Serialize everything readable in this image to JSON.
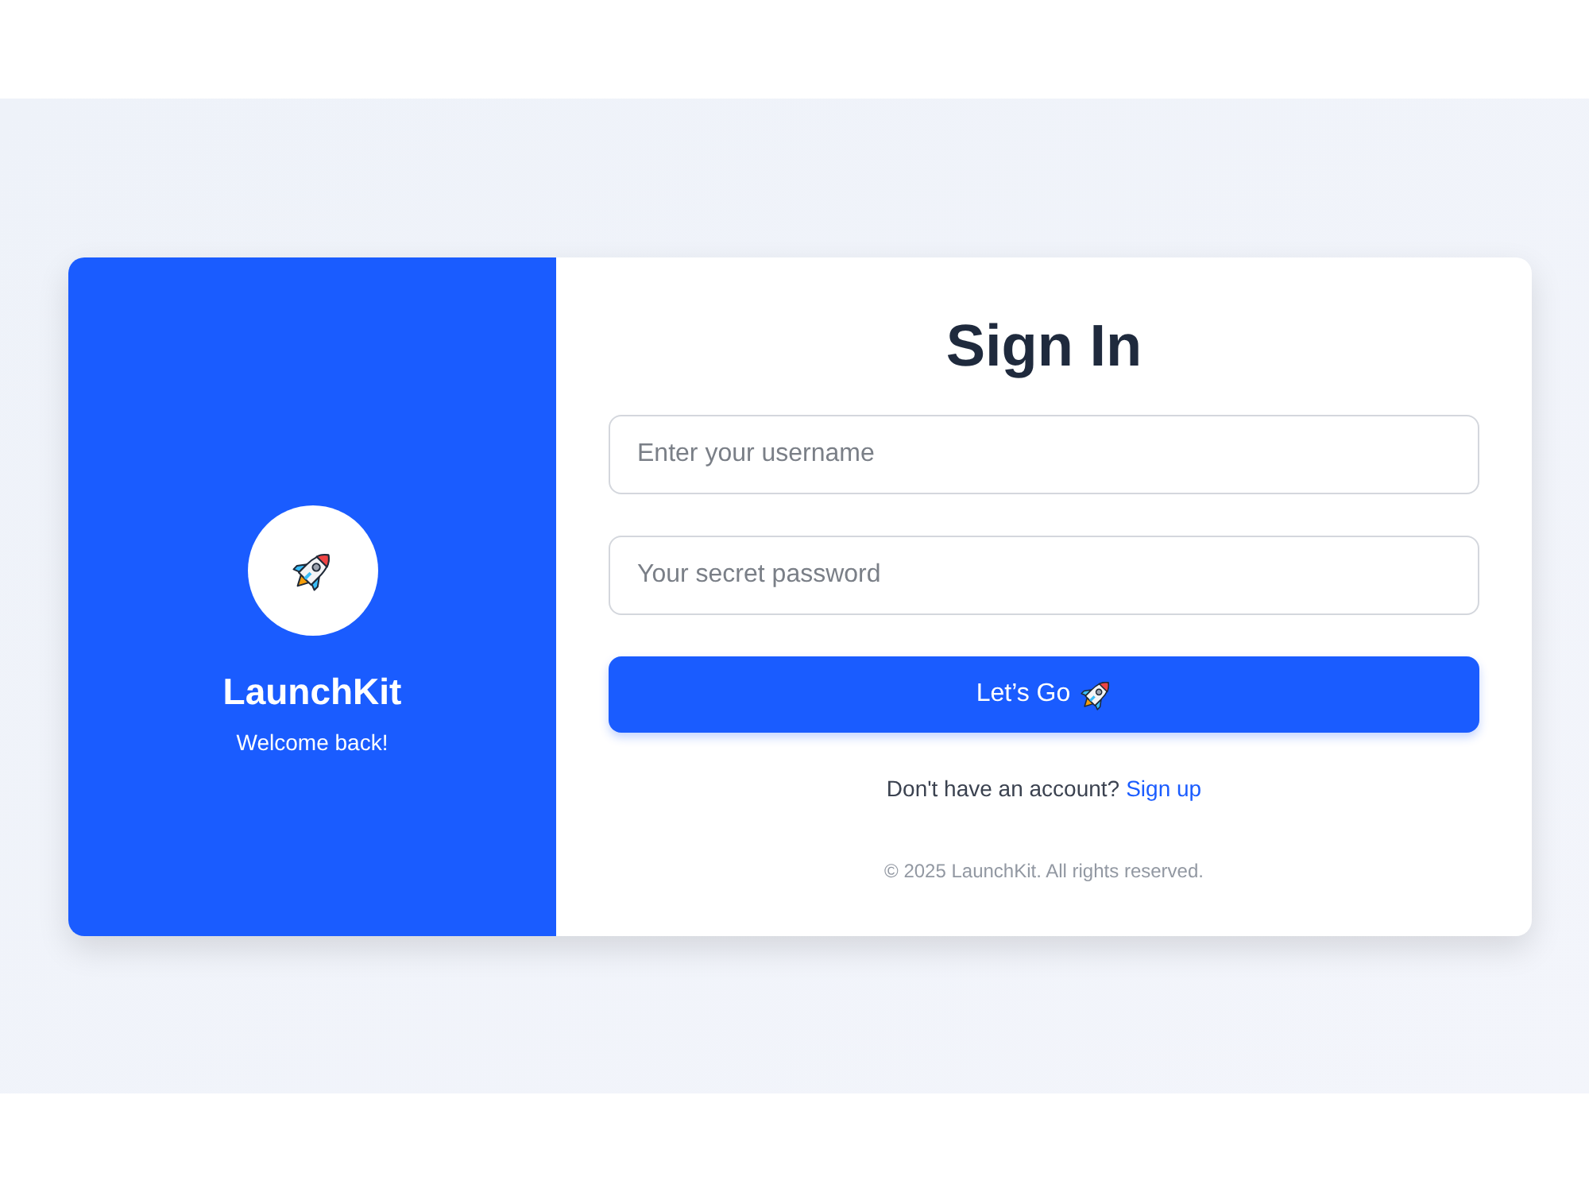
{
  "brand": {
    "name": "LaunchKit",
    "tagline": "Welcome back!"
  },
  "form": {
    "title": "Sign In",
    "fields": [
      {
        "placeholder": "Enter your username"
      },
      {
        "placeholder": "Your secret password"
      }
    ],
    "submit": {
      "label": "Let’s Go"
    }
  },
  "signup_prompt": {
    "text": "Don't have an account?",
    "link": "Sign up"
  },
  "footer": {
    "copyright": "© 2025 LaunchKit. All rights reserved."
  }
}
